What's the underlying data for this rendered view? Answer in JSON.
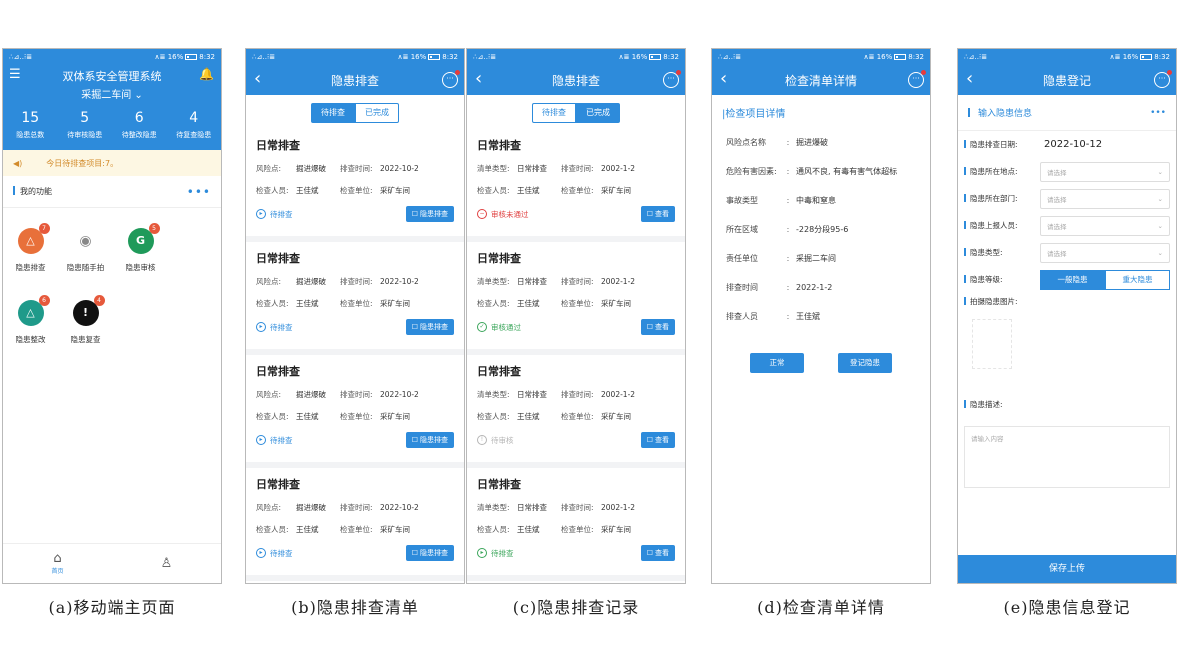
{
  "status_bar": {
    "left": "∴⊿‥⁝≣",
    "right": "∧≣ 16%",
    "time": "8:32"
  },
  "screen_a": {
    "app_title": "双体系安全管理系统",
    "workshop": "采掘二车间",
    "stats": [
      {
        "value": "15",
        "label": "隐患总数"
      },
      {
        "value": "5",
        "label": "待审核隐患"
      },
      {
        "value": "6",
        "label": "待整改隐患"
      },
      {
        "value": "4",
        "label": "待复查隐患"
      }
    ],
    "notice": "今日待排查项目:7。",
    "section_label": "我的功能",
    "more": "•••",
    "functions": [
      {
        "label": "隐患排查",
        "badge": "7",
        "color": "#e8703a",
        "glyph": "△",
        "icon": "triangle-warning-icon"
      },
      {
        "label": "隐患随手拍",
        "badge": "",
        "color": "#ffffff",
        "glyph": "◉",
        "icon": "camera-icon"
      },
      {
        "label": "隐患审核",
        "badge": "5",
        "color": "#1f9a5a",
        "glyph": "G",
        "icon": "audit-icon"
      },
      {
        "label": "隐患整改",
        "badge": "6",
        "color": "#1f9a8a",
        "glyph": "△",
        "icon": "rectify-icon"
      },
      {
        "label": "隐患复查",
        "badge": "4",
        "color": "#111111",
        "glyph": "!",
        "icon": "exclamation-icon"
      }
    ],
    "tabs": [
      {
        "label": "首页",
        "glyph": "⌂"
      },
      {
        "label": "",
        "glyph": "♙"
      }
    ]
  },
  "screen_b": {
    "title": "隐患排查",
    "segments": [
      "待排查",
      "已完成"
    ],
    "cards": [
      {
        "title": "日常排查",
        "k1": "风险点:",
        "v1": "掘进爆破",
        "k2": "排查时间:",
        "v2": "2022-10-2",
        "k3": "检查人员:",
        "v3": "王佳斌",
        "k4": "检查单位:",
        "v4": "采矿车间",
        "status": "待排查",
        "button": "隐患排查"
      },
      {
        "title": "日常排查",
        "k1": "风险点:",
        "v1": "掘进爆破",
        "k2": "排查时间:",
        "v2": "2022-10-2",
        "k3": "检查人员:",
        "v3": "王佳斌",
        "k4": "检查单位:",
        "v4": "采矿车间",
        "status": "待排查",
        "button": "隐患排查"
      },
      {
        "title": "日常排查",
        "k1": "风险点:",
        "v1": "掘进爆破",
        "k2": "排查时间:",
        "v2": "2022-10-2",
        "k3": "检查人员:",
        "v3": "王佳斌",
        "k4": "检查单位:",
        "v4": "采矿车间",
        "status": "待排查",
        "button": "隐患排查"
      },
      {
        "title": "日常排查",
        "k1": "风险点:",
        "v1": "掘进爆破",
        "k2": "排查时间:",
        "v2": "2022-10-2",
        "k3": "检查人员:",
        "v3": "王佳斌",
        "k4": "检查单位:",
        "v4": "采矿车间",
        "status": "待排查",
        "button": "隐患排查"
      }
    ]
  },
  "screen_c": {
    "title": "隐患排查",
    "segments": [
      "待排查",
      "已完成"
    ],
    "cards": [
      {
        "title": "日常排查",
        "k1": "清单类型:",
        "v1": "日常排查",
        "k2": "排查时间:",
        "v2": "2002-1-2",
        "k3": "检查人员:",
        "v3": "王佳斌",
        "k4": "检查单位:",
        "v4": "采矿车间",
        "status": "审核未通过",
        "status_color": "#e04040",
        "glyph": "−",
        "button": "查看"
      },
      {
        "title": "日常排查",
        "k1": "清单类型:",
        "v1": "日常排查",
        "k2": "排查时间:",
        "v2": "2002-1-2",
        "k3": "检查人员:",
        "v3": "王佳斌",
        "k4": "检查单位:",
        "v4": "采矿车间",
        "status": "审核通过",
        "status_color": "#3aa55a",
        "glyph": "✓",
        "button": "查看"
      },
      {
        "title": "日常排查",
        "k1": "清单类型:",
        "v1": "日常排查",
        "k2": "排查时间:",
        "v2": "2002-1-2",
        "k3": "检查人员:",
        "v3": "王佳斌",
        "k4": "检查单位:",
        "v4": "采矿车间",
        "status": "待审核",
        "status_color": "#b5b5b5",
        "glyph": "!",
        "button": "查看"
      },
      {
        "title": "日常排查",
        "k1": "清单类型:",
        "v1": "日常排查",
        "k2": "排查时间:",
        "v2": "2002-1-2",
        "k3": "检查人员:",
        "v3": "王佳斌",
        "k4": "检查单位:",
        "v4": "采矿车间",
        "status": "待排查",
        "status_color": "#3aa55a",
        "glyph": "▸",
        "button": "查看"
      }
    ]
  },
  "screen_d": {
    "title": "检查清单详情",
    "section": "检查项目详情",
    "rows": [
      {
        "k": "风险点名称",
        "v": "掘进爆破"
      },
      {
        "k": "危险有害因素:",
        "v": "通风不良, 有毒有害气体超标"
      },
      {
        "k": "事故类型",
        "v": "中毒和窒息"
      },
      {
        "k": "所在区域",
        "v": "-228分段95-6"
      },
      {
        "k": "责任单位",
        "v": "采掘二车间"
      },
      {
        "k": "排查时间",
        "v": "2022-1-2"
      },
      {
        "k": "排查人员",
        "v": "王佳斌"
      }
    ],
    "buttons": [
      "正常",
      "登记隐患"
    ]
  },
  "screen_e": {
    "title": "隐患登记",
    "section": "输入隐患信息",
    "date_label": "隐患排查日期:",
    "date_value": "2022-10-12",
    "selects": [
      {
        "label": "隐患所在地点:",
        "placeholder": "请选择"
      },
      {
        "label": "隐患所在部门:",
        "placeholder": "请选择"
      },
      {
        "label": "隐患上报人员:",
        "placeholder": "请选择"
      },
      {
        "label": "隐患类型:",
        "placeholder": "请选择"
      }
    ],
    "level_label": "隐患等级:",
    "levels": [
      "一般隐患",
      "重大隐患"
    ],
    "photo_label": "拍摄隐患图片:",
    "desc_label": "隐患描述:",
    "desc_placeholder": "请输入内容",
    "save": "保存上传"
  },
  "captions": [
    "(a)移动端主页面",
    "(b)隐患排查清单",
    "(c)隐患排查记录",
    "(d)检查清单详情",
    "(e)隐患信息登记"
  ],
  "colors": {
    "primary": "#2d8bdb"
  }
}
